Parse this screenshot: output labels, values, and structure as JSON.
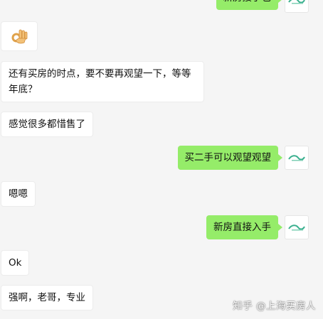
{
  "messages": [
    {
      "side": "out",
      "text": "新房接手也"
    },
    {
      "side": "in",
      "type": "emoji",
      "icon": "ok-hand-emoji"
    },
    {
      "side": "in",
      "text": "还有买房的时点，要不要再观望一下，等等年底？"
    },
    {
      "side": "in",
      "text": "感觉很多都惜售了"
    },
    {
      "side": "out",
      "text": "买二手可以观望观望"
    },
    {
      "side": "in",
      "text": "嗯嗯"
    },
    {
      "side": "out",
      "text": "新房直接入手"
    },
    {
      "side": "in",
      "text": "Ok"
    },
    {
      "side": "in",
      "text": "强啊，老哥，专业"
    }
  ],
  "watermark": "知乎 @上海买房人",
  "colors": {
    "background": "#f5f5f5",
    "incoming_bubble": "#ffffff",
    "outgoing_bubble": "#95ec69",
    "avatar_logo": "#3bb08f"
  }
}
